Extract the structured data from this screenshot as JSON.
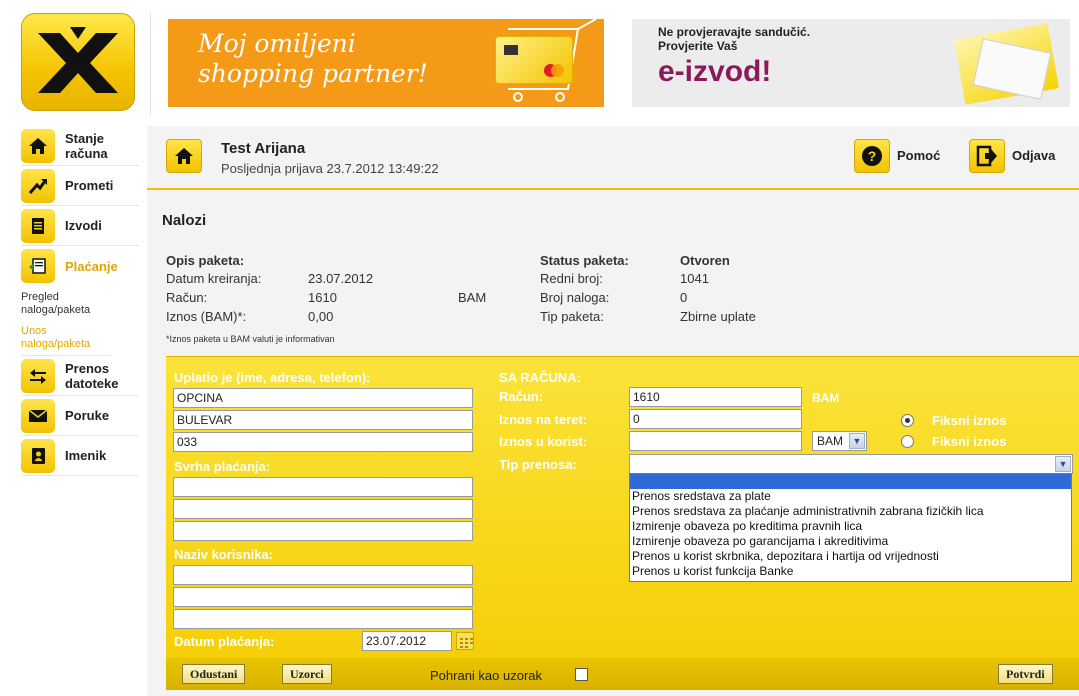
{
  "banners": {
    "shopping": "Moj omiljeni shopping partner!",
    "eizvod_line1": "Ne provjeravajte sandučić.",
    "eizvod_line2": "Provjerite Vaš",
    "eizvod_big": "e-izvod!"
  },
  "nav": {
    "items": [
      {
        "label": "Stanje računa",
        "icon": "home-icon"
      },
      {
        "label": "Prometi",
        "icon": "trend-icon"
      },
      {
        "label": "Izvodi",
        "icon": "document-icon"
      },
      {
        "label": "Plaćanje",
        "icon": "payment-icon"
      },
      {
        "label": "Prenos datoteke",
        "icon": "transfer-icon"
      },
      {
        "label": "Poruke",
        "icon": "envelope-icon"
      },
      {
        "label": "Imenik",
        "icon": "contacts-icon"
      }
    ],
    "sub": {
      "pregled": "Pregled naloga/paketa",
      "unos": "Unos naloga/paketa"
    }
  },
  "header": {
    "user_name": "Test Arijana",
    "last_login": "Posljednja prijava 23.7.2012 13:49:22",
    "help": "Pomoć",
    "logout": "Odjava"
  },
  "section_title": "Nalozi",
  "package": {
    "opis_label": "Opis paketa:",
    "datum_label": "Datum kreiranja:",
    "datum_value": "23.07.2012",
    "racun_label": "Račun:",
    "racun_value": "1610",
    "racun_currency": "BAM",
    "iznos_label": "Iznos (BAM)*:",
    "iznos_value": "0,00",
    "status_label": "Status paketa:",
    "status_value": "Otvoren",
    "redni_label": "Redni broj:",
    "redni_value": "1041",
    "broj_label": "Broj naloga:",
    "broj_value": "0",
    "tip_label": "Tip paketa:",
    "tip_value": "Zbirne uplate",
    "note": "*Iznos paketa u BAM valuti je informativan"
  },
  "form": {
    "uplatio_label": "Uplatio je (ime, adresa, telefon):",
    "uplatio_lines": [
      "OPCINA",
      "BULEVAR",
      "033"
    ],
    "svrha_label": "Svrha plaćanja:",
    "svrha_lines": [
      "",
      "",
      ""
    ],
    "naziv_label": "Naziv korisnika:",
    "naziv_lines": [
      "",
      "",
      ""
    ],
    "datum_label": "Datum plaćanja:",
    "datum_value": "23.07.2012",
    "sa_racuna": "SA RAČUNA:",
    "racun_label": "Račun:",
    "racun_value": "1610",
    "racun_currency": "BAM",
    "teret_label": "Iznos na teret:",
    "teret_value": "0",
    "korist_label": "Iznos u korist:",
    "korist_value": "",
    "korist_currency": "BAM",
    "fiksni1": "Fiksni iznos",
    "fiksni2": "Fiksni iznos",
    "tip_label": "Tip prenosa:",
    "tip_value": "",
    "tip_options": [
      "",
      "Prenos sredstava za plate",
      "Prenos sredstava za plaćanje administrativnih zabrana fizičkih lica",
      "Izmirenje obaveza po kreditima pravnih lica",
      "Izmirenje obaveza po garancijama i akreditivima",
      "Prenos u korist skrbnika, depozitara i hartija od vrijednosti",
      "Prenos u korist funkcija Banke"
    ]
  },
  "bottom": {
    "odustani": "Odustani",
    "uzorci": "Uzorci",
    "pohrani": "Pohrani kao uzorak",
    "potvrdi": "Potvrdi"
  },
  "colors": {
    "brand_yellow": "#f5cf08",
    "active_nav": "#e0a500",
    "banner_orange": "#f49a17",
    "eizvod_purple": "#8a1a5a"
  }
}
